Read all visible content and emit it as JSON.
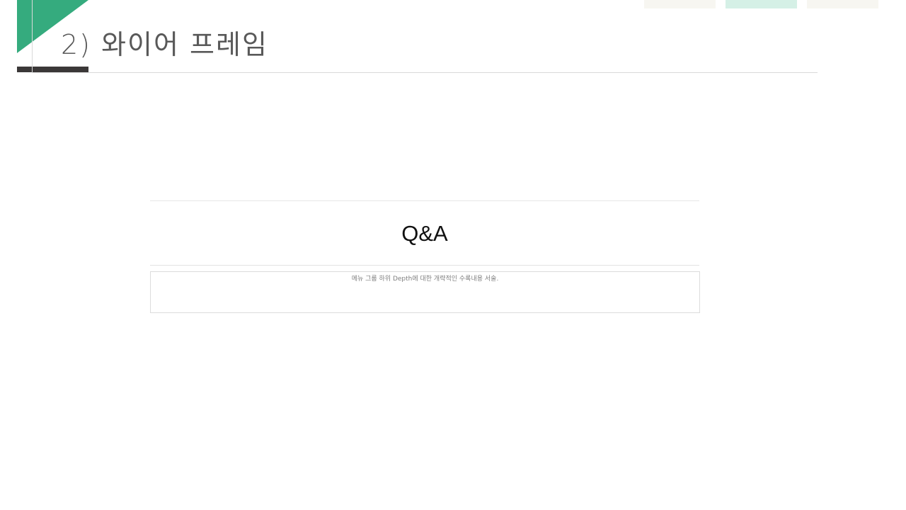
{
  "slide": {
    "title": "2) 와이어 프레임",
    "accent_color": "#35ab7e",
    "bar_color": "#3b3838",
    "tabs": [
      {
        "color": "#f7f6f1"
      },
      {
        "color": "#d5f0e6"
      },
      {
        "color": "#f7f6f1"
      }
    ]
  },
  "wireframe": {
    "heading": "Q&A",
    "description": "메뉴 그룹 하위 Depth에 대한 개략적인 수록내용 서술."
  }
}
